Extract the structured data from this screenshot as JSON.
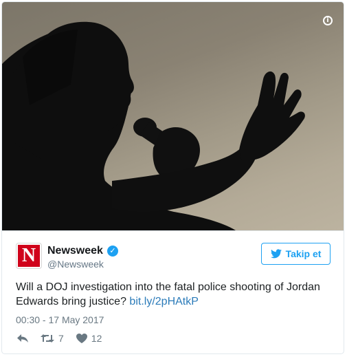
{
  "tweet": {
    "author": {
      "display_name": "Newsweek",
      "handle": "@Newsweek",
      "avatar_letter": "N",
      "verified": true
    },
    "follow_button_label": "Takip et",
    "text": "Will a DOJ investigation into the fatal police shooting of Jordan Edwards bring justice? ",
    "link_text": "bit.ly/2pHAtkP",
    "timestamp": "00:30 - 17 May 2017",
    "actions": {
      "reply": {
        "icon": "reply-icon"
      },
      "retweet": {
        "icon": "retweet-icon",
        "count": "7"
      },
      "like": {
        "icon": "heart-icon",
        "count": "12"
      }
    },
    "media": {
      "info_icon": "info-icon"
    }
  },
  "colors": {
    "brand_blue": "#1da1f2",
    "link_blue": "#2b7bb9",
    "avatar_red": "#d0021b",
    "muted_text": "#697882"
  }
}
